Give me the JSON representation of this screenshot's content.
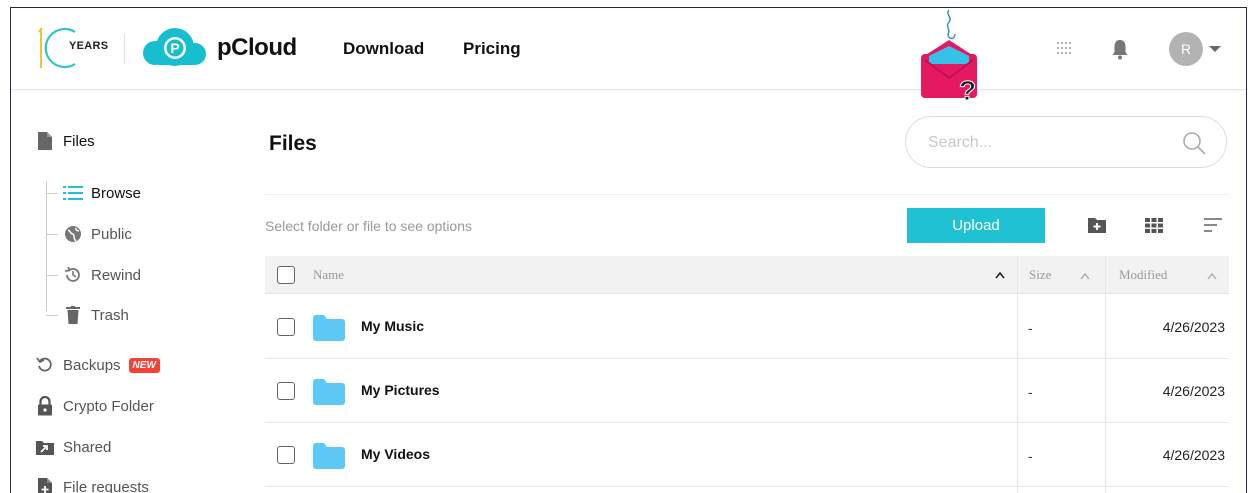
{
  "header": {
    "years_label": "YEARS",
    "brand": "pCloud",
    "nav": [
      {
        "label": "Download"
      },
      {
        "label": "Pricing"
      }
    ],
    "avatar_initial": "R",
    "icons": [
      "years-10-logo",
      "pcloud-logo",
      "promo-envelope-icon",
      "apps-grid-icon",
      "bell-icon",
      "chevron-down-icon"
    ]
  },
  "sidebar": {
    "files": "Files",
    "browse": "Browse",
    "public": "Public",
    "rewind": "Rewind",
    "trash": "Trash",
    "backups": "Backups",
    "new_badge": "NEW",
    "crypto": "Crypto Folder",
    "shared": "Shared",
    "file_requests": "File requests"
  },
  "main": {
    "title": "Files",
    "search_placeholder": "Search...",
    "hint": "Select folder or file to see options",
    "upload_label": "Upload",
    "columns": {
      "name": "Name",
      "size": "Size",
      "modified": "Modified"
    },
    "rows": [
      {
        "name": "My Music",
        "size": "-",
        "modified": "4/26/2023"
      },
      {
        "name": "My Pictures",
        "size": "-",
        "modified": "4/26/2023"
      },
      {
        "name": "My Videos",
        "size": "-",
        "modified": "4/26/2023"
      }
    ]
  },
  "colors": {
    "accent": "#20c1d3",
    "logo_blue": "#17bed0",
    "folder": "#5ec8f5",
    "badge": "#f44336",
    "promo": "#e5195f"
  }
}
